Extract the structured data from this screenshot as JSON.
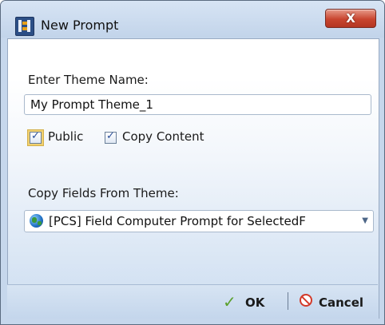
{
  "window": {
    "title": "New Prompt",
    "close_label": "X"
  },
  "form": {
    "theme_name_label": "Enter Theme Name:",
    "theme_name_value": "My Prompt Theme_1",
    "public_label": "Public",
    "public_checked": true,
    "copy_content_label": "Copy Content",
    "copy_content_checked": true,
    "copy_fields_label": "Copy Fields From Theme:",
    "copy_fields_selected": "[PCS] Field Computer Prompt for SelectedF"
  },
  "footer": {
    "ok_label": "OK",
    "cancel_label": "Cancel"
  },
  "icons": {
    "app": "app-icon",
    "globe": "globe-icon",
    "ok": "checkmark-icon",
    "cancel": "no-entry-icon",
    "dropdown": "chevron-down-icon"
  },
  "colors": {
    "title_bar": "#c8d9ee",
    "close_button": "#c8452f",
    "ok_icon": "#5aa02c",
    "cancel_icon": "#d33a2a"
  }
}
